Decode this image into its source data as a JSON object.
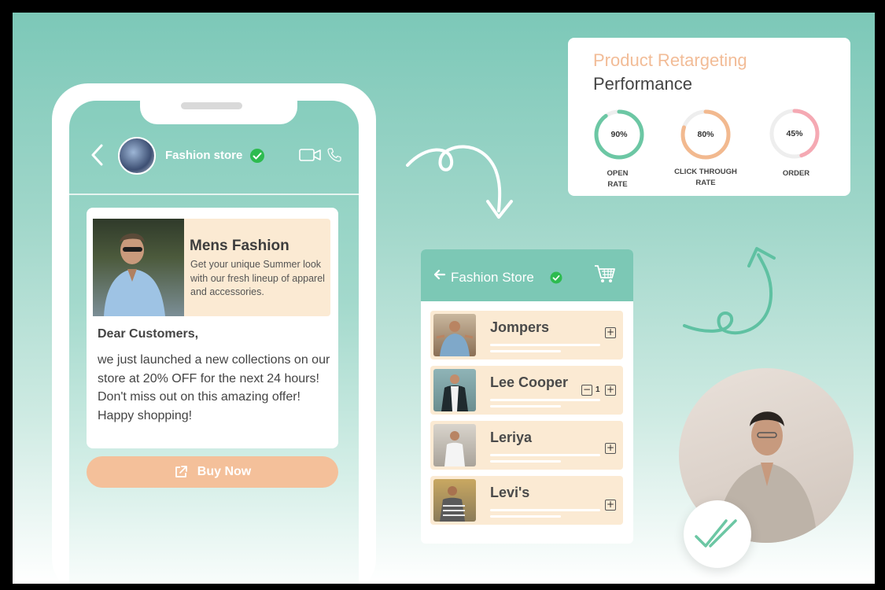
{
  "chat": {
    "store_name": "Fashion store",
    "promo": {
      "title": "Mens Fashion",
      "description": "Get your unique Summer look with our fresh lineup of apparel and accessories."
    },
    "greeting": "Dear Customers,",
    "body": "we just launched a new collections on our store at 20% OFF for the next 24 hours! Don't miss out on this amazing offer!\nHappy shopping!",
    "buy_button": "Buy Now"
  },
  "performance": {
    "title_line1": "Product Retargeting",
    "title_line2": "Performance",
    "metrics": [
      {
        "value": "90%",
        "percent": 90,
        "label_1": "OPEN",
        "label_2": "RATE",
        "color": "#6cc7a4"
      },
      {
        "value": "80%",
        "percent": 80,
        "label_1": "CLICK THROUGH",
        "label_2": "RATE",
        "color": "#f2b98f"
      },
      {
        "value": "45%",
        "percent": 45,
        "label_1": "ORDER",
        "label_2": "",
        "color": "#f5a9b3"
      }
    ]
  },
  "store": {
    "title": "Fashion Store",
    "items": [
      {
        "name": "Jompers"
      },
      {
        "name": "Lee Cooper",
        "quantity": "1"
      },
      {
        "name": "Leriya"
      },
      {
        "name": "Levi's"
      }
    ]
  },
  "colors": {
    "accent_teal": "#7cc8b5",
    "accent_peach": "#f4c09a",
    "verified_green": "#2dbb4f"
  },
  "icons": [
    "back-chevron-icon",
    "verified-check-icon",
    "video-call-icon",
    "phone-call-icon",
    "external-link-icon",
    "back-arrow-icon",
    "shopping-cart-icon",
    "plus-icon",
    "minus-icon",
    "double-check-icon",
    "curly-arrow-icon"
  ]
}
